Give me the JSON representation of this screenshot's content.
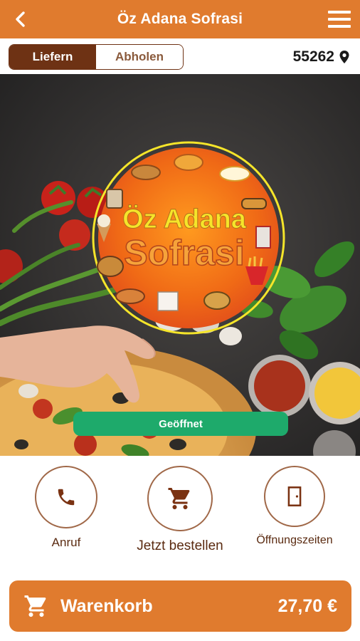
{
  "header": {
    "title": "Öz Adana Sofrasi",
    "back_icon": "chevron-left-icon",
    "menu_icon": "hamburger-menu-icon"
  },
  "order_mode": {
    "options": [
      "Liefern",
      "Abholen"
    ],
    "selected": "Liefern"
  },
  "location": {
    "postal_code": "55262",
    "icon": "map-pin-icon"
  },
  "hero": {
    "logo_line1": "Öz Adana",
    "logo_line2": "Sofrasi",
    "status_label": "Geöffnet"
  },
  "actions": [
    {
      "label": "Anruf",
      "icon": "phone-icon"
    },
    {
      "label": "Jetzt bestellen",
      "icon": "shopping-cart-icon"
    },
    {
      "label": "Öffnungszeiten",
      "icon": "door-icon"
    }
  ],
  "cart": {
    "label": "Warenkorb",
    "total": "27,70 €",
    "icon": "shopping-cart-icon"
  },
  "colors": {
    "primary_orange": "#e07b2e",
    "dark_brown": "#6e3214",
    "status_green": "#1eaa6b",
    "logo_yellow": "#f5e52a"
  }
}
